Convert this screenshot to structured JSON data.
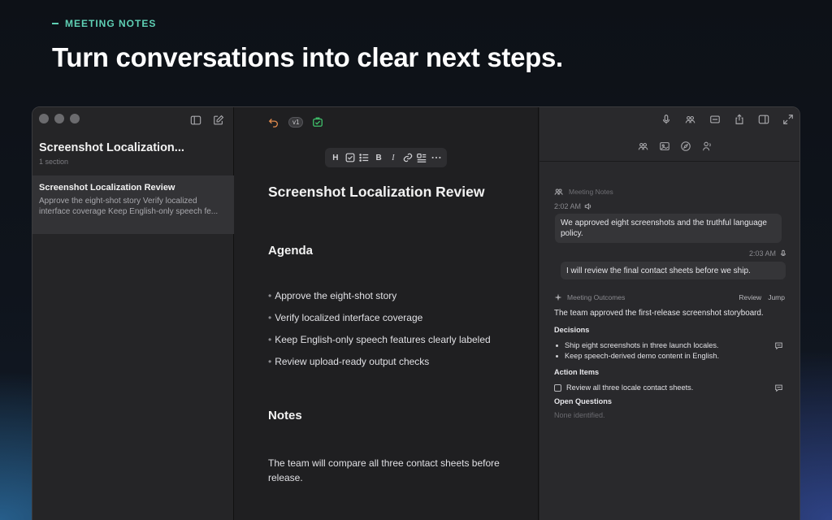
{
  "marketing": {
    "eyebrow": "MEETING NOTES",
    "headline": "Turn conversations into clear next steps."
  },
  "sidebar": {
    "title": "Screenshot Localization...",
    "subtitle": "1 section",
    "note": {
      "title": "Screenshot Localization Review",
      "preview": "Approve the eight-shot story Verify localized interface coverage Keep English-only speech fe..."
    }
  },
  "editor": {
    "version_badge": "v1",
    "toolbar": [
      "H",
      "B",
      "I"
    ],
    "title": "Screenshot Localization Review",
    "agenda_heading": "Agenda",
    "agenda_items": [
      "Approve the eight-shot story",
      "Verify localized interface coverage",
      "Keep English-only speech features clearly labeled",
      "Review upload-ready output checks"
    ],
    "notes_heading": "Notes",
    "notes_text": "The team will compare all three contact sheets before release."
  },
  "panel": {
    "transcript_label": "Meeting Notes",
    "msg1_time": "2:02 AM",
    "msg1_text": "We approved eight screenshots and the truthful language policy.",
    "msg2_time": "2:03 AM",
    "msg2_text": "I will review the final contact sheets before we ship.",
    "outcomes_label": "Meeting Outcomes",
    "review_link": "Review",
    "jump_link": "Jump",
    "summary": "The team approved the first-release screenshot storyboard.",
    "decisions_heading": "Decisions",
    "decisions": [
      "Ship eight screenshots in three launch locales.",
      "Keep speech-derived demo content in English."
    ],
    "action_heading": "Action Items",
    "action_items": [
      "Review all three locale contact sheets."
    ],
    "questions_heading": "Open Questions",
    "questions_empty": "None identified."
  },
  "colors": {
    "accent": "#5fd0b5",
    "undo": "#e08a4d",
    "sync": "#3fbf6a"
  }
}
